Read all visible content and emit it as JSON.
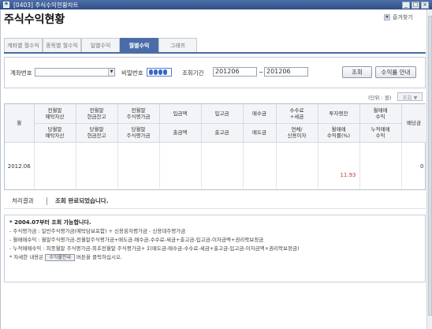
{
  "titlebar": {
    "icon": "app-icon",
    "title": "[0403] 주식수익현황차트",
    "btn_min": "_",
    "btn_max": "□",
    "btn_close": "×"
  },
  "page": {
    "title": "주식수익현황",
    "favorite_label": "즐겨찾기"
  },
  "tabs": [
    {
      "label": "계좌별 월수익",
      "active": false
    },
    {
      "label": "종목별 월수익",
      "active": false
    },
    {
      "label": "일별수익",
      "active": false
    },
    {
      "label": "월별수익",
      "active": true
    },
    {
      "label": "그래프",
      "active": false
    }
  ],
  "filter": {
    "account_label": "계좌번호",
    "account_value": "",
    "password_label": "비밀번호",
    "period_label": "조회기간",
    "from": "201206",
    "tilde": "~",
    "to": "201206",
    "search_label": "조회",
    "guide_label": "수익률 안내"
  },
  "unit": {
    "label": "(단위 : 원)",
    "next_label": "조회 ▼"
  },
  "table": {
    "headers_top": [
      "",
      "전월말\n예탁자산",
      "전월말\n현금잔고",
      "전월말\n주식평가금",
      "입금액",
      "입고금",
      "매수금",
      "수수료\n+세금",
      "투자평잔",
      "월매매\n수익",
      ""
    ],
    "headers_bottom": [
      "월",
      "당월말\n예탁자산",
      "당월말\n현금잔고",
      "당월말\n주식평가금",
      "출금액",
      "출고금",
      "매도금",
      "연체/\n신용이자",
      "월매매\n수익률(%)",
      "누적매매\n수익",
      "배당금"
    ],
    "rows": [
      {
        "month": "2012.06",
        "rate": "11.93",
        "dividend": "0"
      }
    ]
  },
  "result": {
    "label": "처리결과",
    "message": "조회 완료되었습니다."
  },
  "notes": {
    "head": "* 2004.07부터 조회 가능합니다.",
    "lines": [
      "- 주식평가금 : 일반주식평가금(예탁담보포함) + 신용융자평가금 - 신용대주평가금",
      "- 월매매수익 : 월말주식평가금-전월말주식평가금+매도금-매수금-수수료-세금+출고금-입고금-이자금액+권리락보정금",
      "- 누적매매수익 : 최종월말 주식평가금-최초전월말 주식평가금+ Σ(매도금-매수금-수수료-세금+출고금-입고금-이자금액+권리락보정금)"
    ],
    "tail_prefix": "* 자세한 내용은",
    "tail_button": "수익률안내",
    "tail_suffix": "버튼을 클릭하십시오."
  }
}
